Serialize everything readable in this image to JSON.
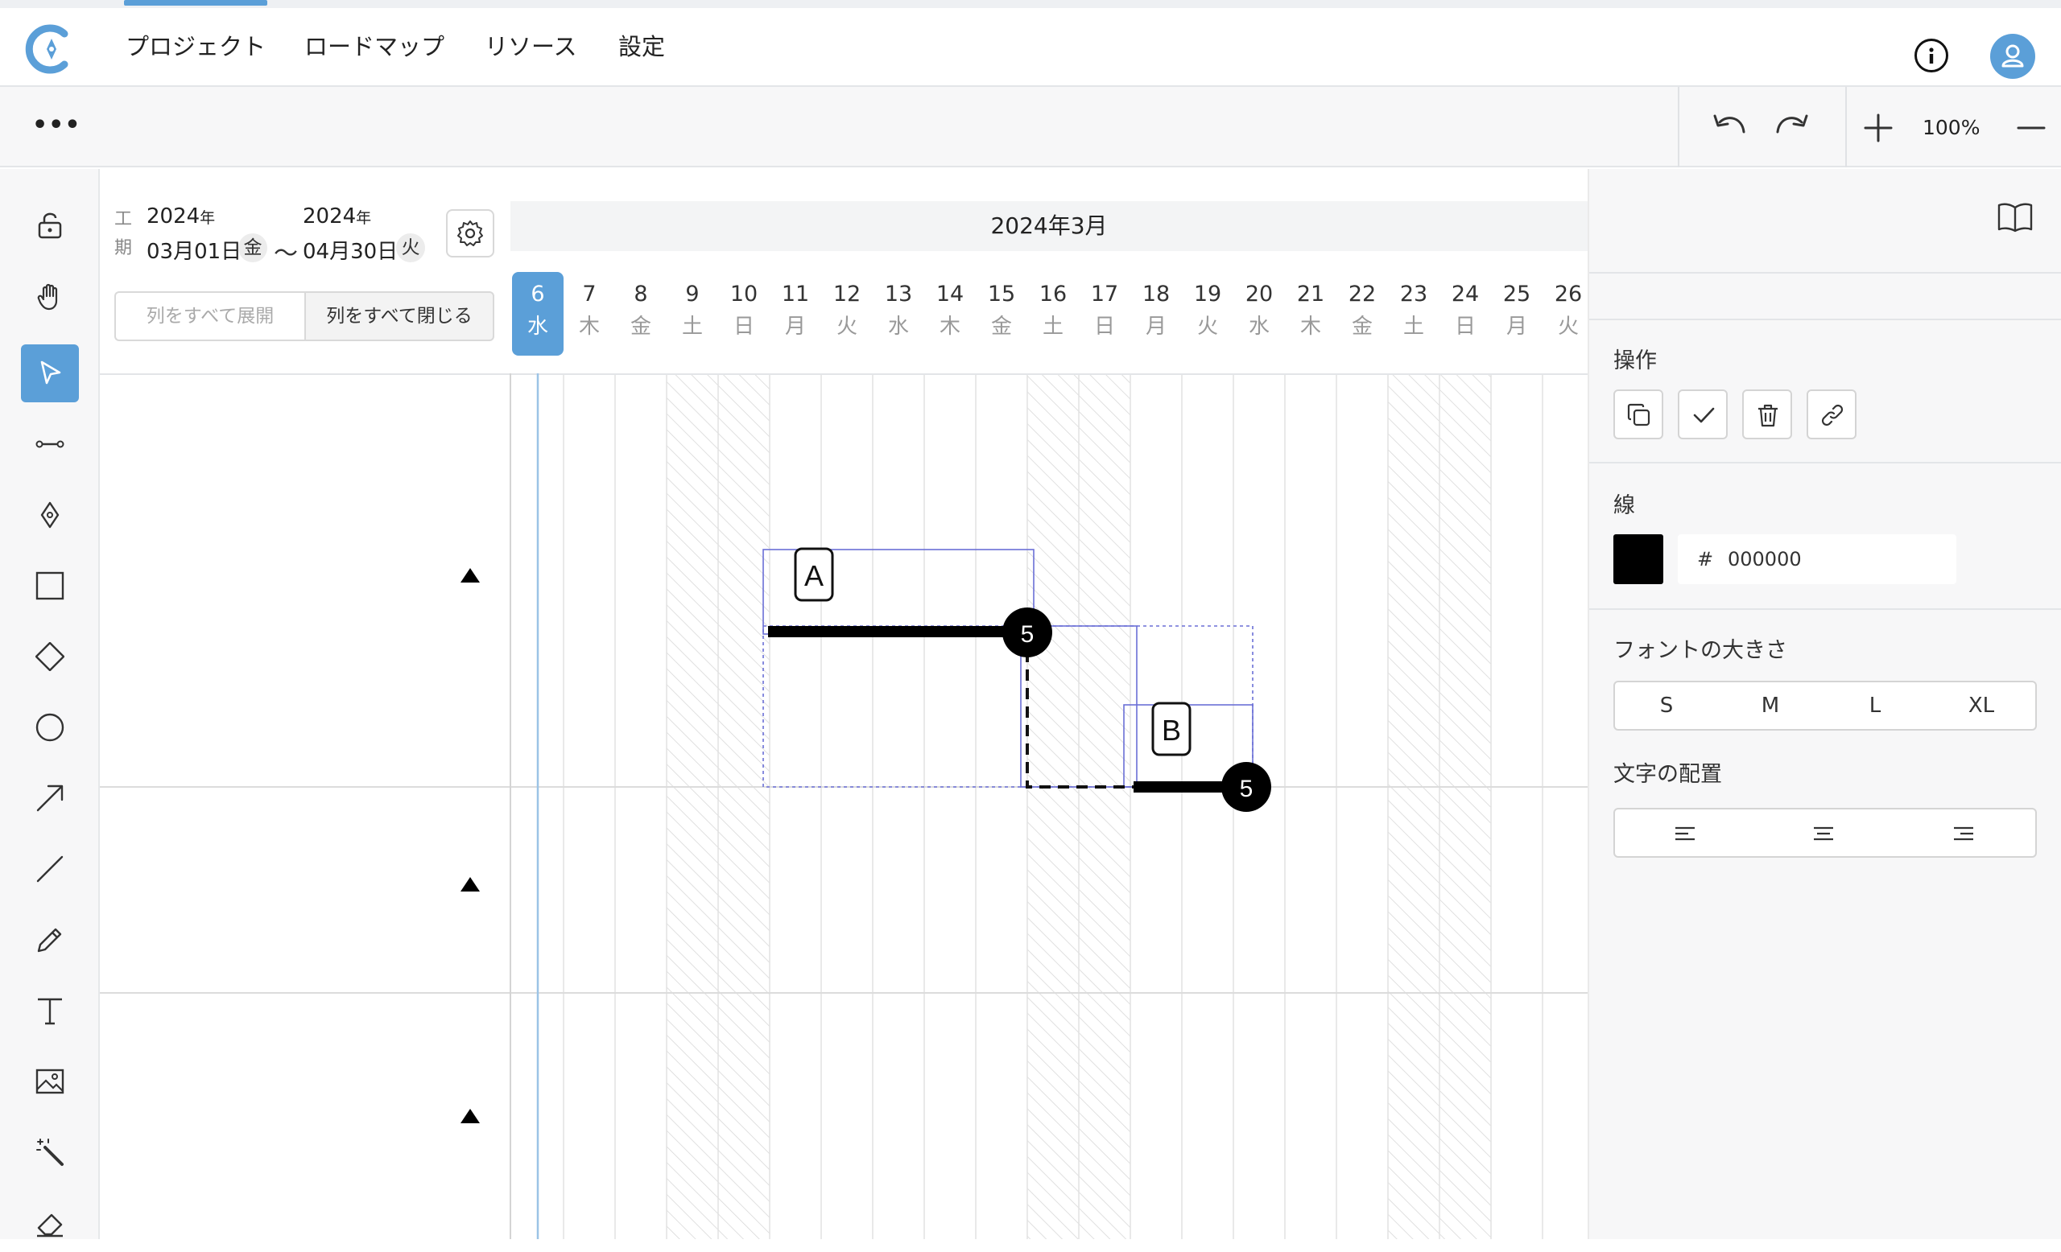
{
  "nav": {
    "items": [
      {
        "label": "プロジェクト"
      },
      {
        "label": "ロードマップ"
      },
      {
        "label": "リソース"
      },
      {
        "label": "設定"
      }
    ],
    "active_index": 0
  },
  "toolbar": {
    "more_label": "•••",
    "zoom": "100%"
  },
  "period": {
    "label_top": "工",
    "label_bottom": "期",
    "start_year": "2024",
    "end_year": "2024",
    "year_suffix": "年",
    "start_date": "03月01日",
    "start_weekday": "金",
    "separator": "～",
    "end_date": "04月30日",
    "end_weekday": "火"
  },
  "columns": {
    "expand_all": "列をすべて展開",
    "collapse_all": "列をすべて閉じる"
  },
  "timeline": {
    "month": "2024年3月",
    "days": [
      {
        "d": "6",
        "w": "水",
        "today": true
      },
      {
        "d": "7",
        "w": "木"
      },
      {
        "d": "8",
        "w": "金"
      },
      {
        "d": "9",
        "w": "土"
      },
      {
        "d": "10",
        "w": "日"
      },
      {
        "d": "11",
        "w": "月"
      },
      {
        "d": "12",
        "w": "火"
      },
      {
        "d": "13",
        "w": "水"
      },
      {
        "d": "14",
        "w": "木"
      },
      {
        "d": "15",
        "w": "金"
      },
      {
        "d": "16",
        "w": "土"
      },
      {
        "d": "17",
        "w": "日"
      },
      {
        "d": "18",
        "w": "月"
      },
      {
        "d": "19",
        "w": "火"
      },
      {
        "d": "20",
        "w": "水"
      },
      {
        "d": "21",
        "w": "木"
      },
      {
        "d": "22",
        "w": "金"
      },
      {
        "d": "23",
        "w": "土"
      },
      {
        "d": "24",
        "w": "日"
      },
      {
        "d": "25",
        "w": "月"
      },
      {
        "d": "26",
        "w": "火"
      }
    ]
  },
  "canvas": {
    "task_a": {
      "label": "A",
      "badge": "5"
    },
    "task_b": {
      "label": "B",
      "badge": "5"
    }
  },
  "panel": {
    "operations_label": "操作",
    "line_label": "線",
    "color_hash": "#",
    "color_value": "000000",
    "line_color": "#000000",
    "font_size_label": "フォントの大きさ",
    "font_sizes": [
      "S",
      "M",
      "L",
      "XL"
    ],
    "text_align_label": "文字の配置"
  },
  "colors": {
    "accent": "#5b9fd8",
    "weekend_hatch": "#d6d6d6",
    "selection": "#6b6fd6"
  }
}
